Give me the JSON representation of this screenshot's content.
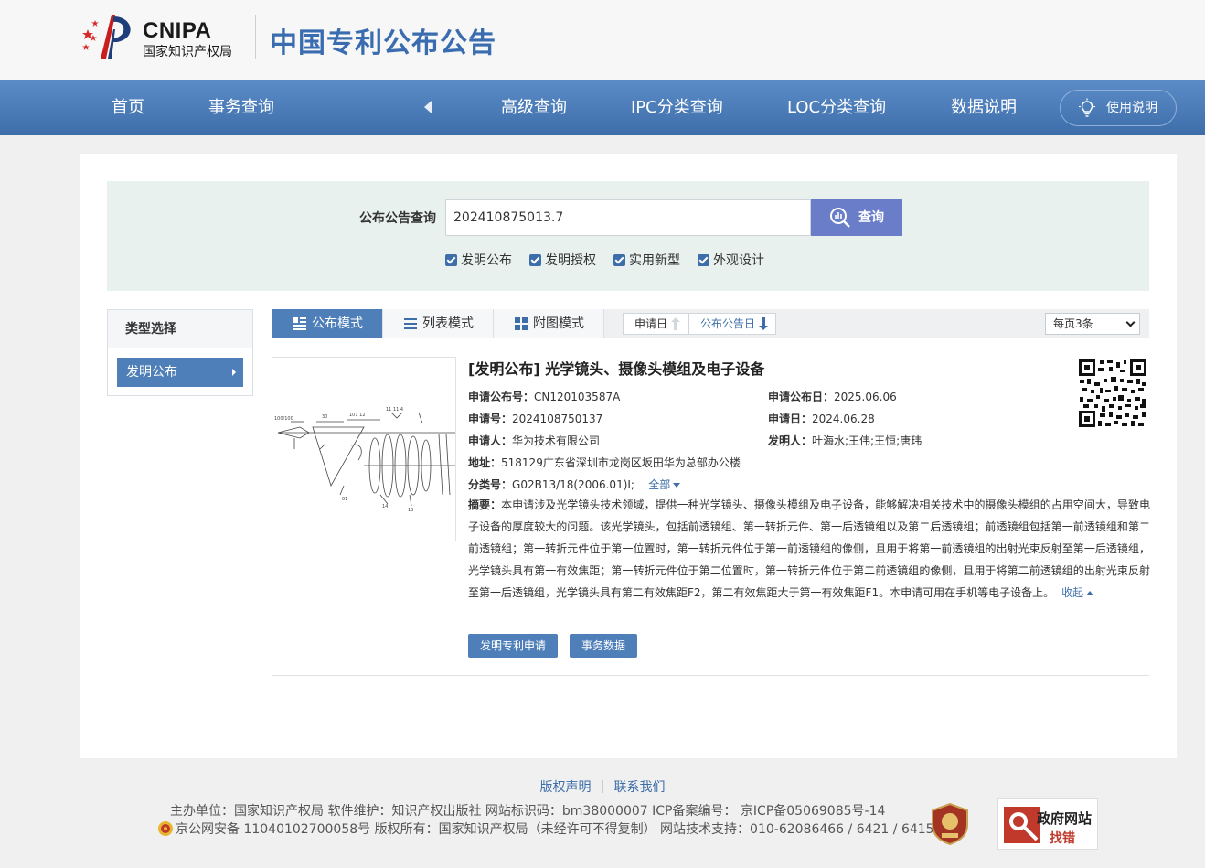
{
  "header": {
    "logo_en": "CNIPA",
    "logo_cn": "国家知识产权局",
    "site_title": "中国专利公布公告"
  },
  "nav": {
    "items": [
      "首页",
      "事务查询",
      "高级查询",
      "IPC分类查询",
      "LOC分类查询",
      "数据说明"
    ],
    "help": "使用说明"
  },
  "search": {
    "label": "公布公告查询",
    "value": "202410875013.7",
    "button": "查询",
    "checkboxes": [
      {
        "label": "发明公布",
        "checked": true
      },
      {
        "label": "发明授权",
        "checked": true
      },
      {
        "label": "实用新型",
        "checked": true
      },
      {
        "label": "外观设计",
        "checked": true
      }
    ]
  },
  "sidebar": {
    "title": "类型选择",
    "items": [
      {
        "label": "发明公布",
        "selected": true
      }
    ]
  },
  "toolbar": {
    "modes": [
      {
        "label": "公布模式",
        "icon": "publish-mode-icon",
        "active": true
      },
      {
        "label": "列表模式",
        "icon": "list-icon",
        "active": false
      },
      {
        "label": "附图模式",
        "icon": "grid-icon",
        "active": false
      }
    ],
    "sort": [
      {
        "label": "申请日",
        "direction": "up"
      },
      {
        "label": "公布公告日",
        "direction": "down",
        "active": true
      }
    ],
    "per_page": "每页3条"
  },
  "result": {
    "title": "[发明公布] 光学镜头、摄像头模组及电子设备",
    "pub_no_label": "申请公布号：",
    "pub_no": "CN120103587A",
    "pub_date_label": "申请公布日：",
    "pub_date": "2025.06.06",
    "app_no_label": "申请号：",
    "app_no": "2024108750137",
    "app_date_label": "申请日：",
    "app_date": "2024.06.28",
    "applicant_label": "申请人：",
    "applicant": "华为技术有限公司",
    "inventor_label": "发明人：",
    "inventor": "叶海水;王伟;王恒;唐玮",
    "address_label": "地址：",
    "address": "518129广东省深圳市龙岗区坂田华为总部办公楼",
    "class_label": "分类号：",
    "class": "G02B13/18(2006.01)I;",
    "class_all": "全部",
    "abstract_label": "摘要：",
    "abstract": "本申请涉及光学镜头技术领域，提供一种光学镜头、摄像头模组及电子设备，能够解决相关技术中的摄像头模组的占用空间大，导致电子设备的厚度较大的问题。该光学镜头，包括前透镜组、第一转折元件、第一后透镜组以及第二后透镜组；前透镜组包括第一前透镜组和第二前透镜组；第一转折元件位于第一位置时，第一转折元件位于第一前透镜组的像侧，且用于将第一前透镜组的出射光束反射至第一后透镜组，光学镜头具有第一有效焦距；第一转折元件位于第二位置时，第一转折元件位于第二前透镜组的像侧，且用于将第二前透镜组的出射光束反射至第一后透镜组，光学镜头具有第二有效焦距F2，第二有效焦距大于第一有效焦距F1。本申请可用在手机等电子设备上。",
    "collapse": "收起",
    "btn_apply": "发明专利申请",
    "btn_affairs": "事务数据"
  },
  "footer": {
    "links": [
      "版权声明",
      "联系我们"
    ],
    "line1": "主办单位：国家知识产权局   软件维护：知识产权出版社   网站标识码：bm38000007   ICP备案编号： 京ICP备05069085号-14",
    "line2": "京公网安备 11040102700058号  版权所有：国家知识产权局（未经许可不得复制）  网站技术支持：010-62086466 / 6421 / 6415",
    "gov_badge_1": "政府网站",
    "gov_badge_2": "找错"
  },
  "colors": {
    "nav": "#4a7bb7",
    "accent": "#3d6ea9",
    "search_button": "#6a7dc8",
    "title": "#3a6cb0"
  }
}
